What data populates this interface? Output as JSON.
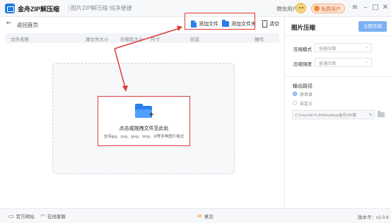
{
  "titlebar": {
    "app_name": "金舟ZIP解压缩",
    "tagline": "图片ZIP解压缩 纯净便捷",
    "user_name": "微信用户",
    "vip_label": "免费用户",
    "minimize": "–",
    "maximize": "□",
    "close": "✕",
    "menu": "≡"
  },
  "toolbar": {
    "back_label": "返回首页",
    "add_file": "添加文件",
    "add_folder": "添加文件夹",
    "clear": "清空"
  },
  "table": {
    "headers": [
      "文件名称",
      "源文件大小",
      "压缩后大小",
      "尺寸",
      "状态",
      "操作"
    ]
  },
  "dropzone": {
    "title": "点击或拖拽文件至此处",
    "subtitle": "支持jpg、png、jpeg、bmp、tif等多种图片格式"
  },
  "right_panel": {
    "title": "图片压缩",
    "compress_button": "立即压缩",
    "mode_label": "压缩模式",
    "mode_value": "快速压缩",
    "strength_label": "压缩强度",
    "strength_value": "普通压缩",
    "output_title": "输出路径",
    "option_source": "原目录",
    "option_custom": "自定义",
    "path_value": "C:\\Users\\KYLIN\\Desktop\\金舟ZIP解"
  },
  "bottombar": {
    "website": "官方网站",
    "service": "在线客服",
    "feedback": "意见",
    "version": "版本号：v2.0.6"
  },
  "colors": {
    "accent": "#2a7fe8",
    "highlight": "#e03a3a",
    "compress_button": "#7bb1f2"
  }
}
